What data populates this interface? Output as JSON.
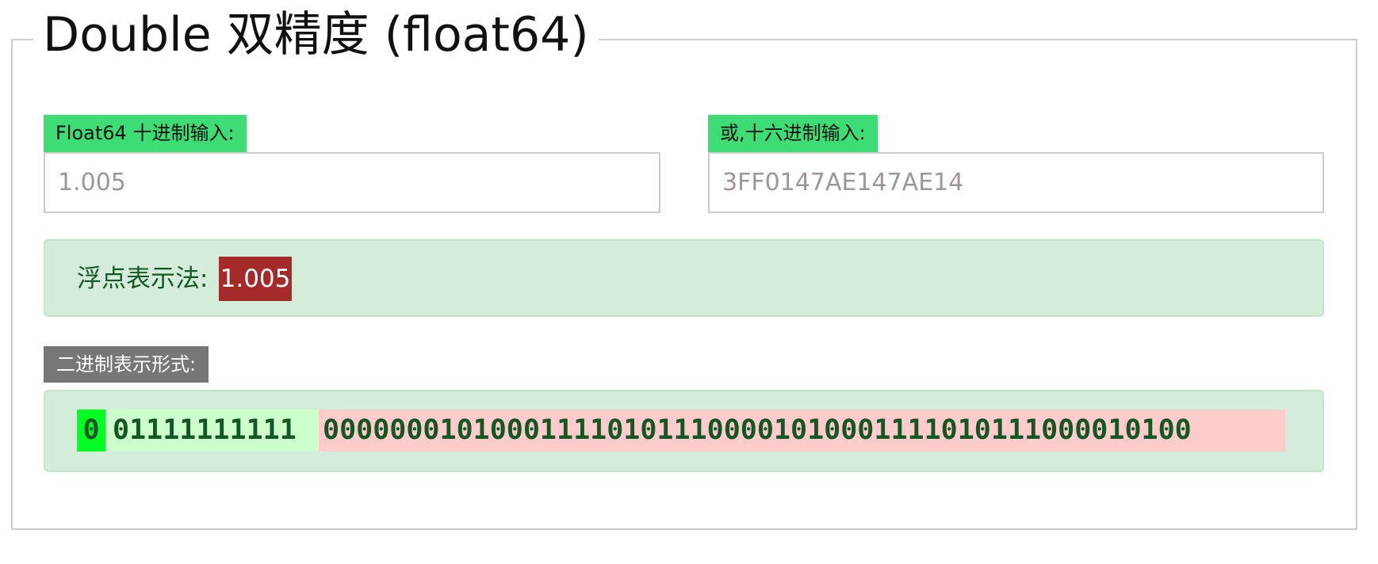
{
  "title": "Double 双精度 (float64)",
  "decimal_input": {
    "label": "Float64 十进制输入:",
    "value": "1.005"
  },
  "hex_input": {
    "label": "或,十六进制输入:",
    "value": "3FF0147AE147AE14"
  },
  "float_repr": {
    "label": "浮点表示法:",
    "value": "1.005"
  },
  "binary_repr": {
    "label": "二进制表示形式:",
    "sign": "0",
    "exponent": "01111111111",
    "mantissa": "0000000101000111101011100001010001111010111000010100"
  },
  "colors": {
    "input_label_bg": "#3ddc74",
    "value_badge_bg": "#a52a2a",
    "panel_bg": "#d4edda",
    "sign_bg": "#00ff22",
    "exponent_bg": "#ccffcc",
    "mantissa_bg": "#ffcccc"
  }
}
